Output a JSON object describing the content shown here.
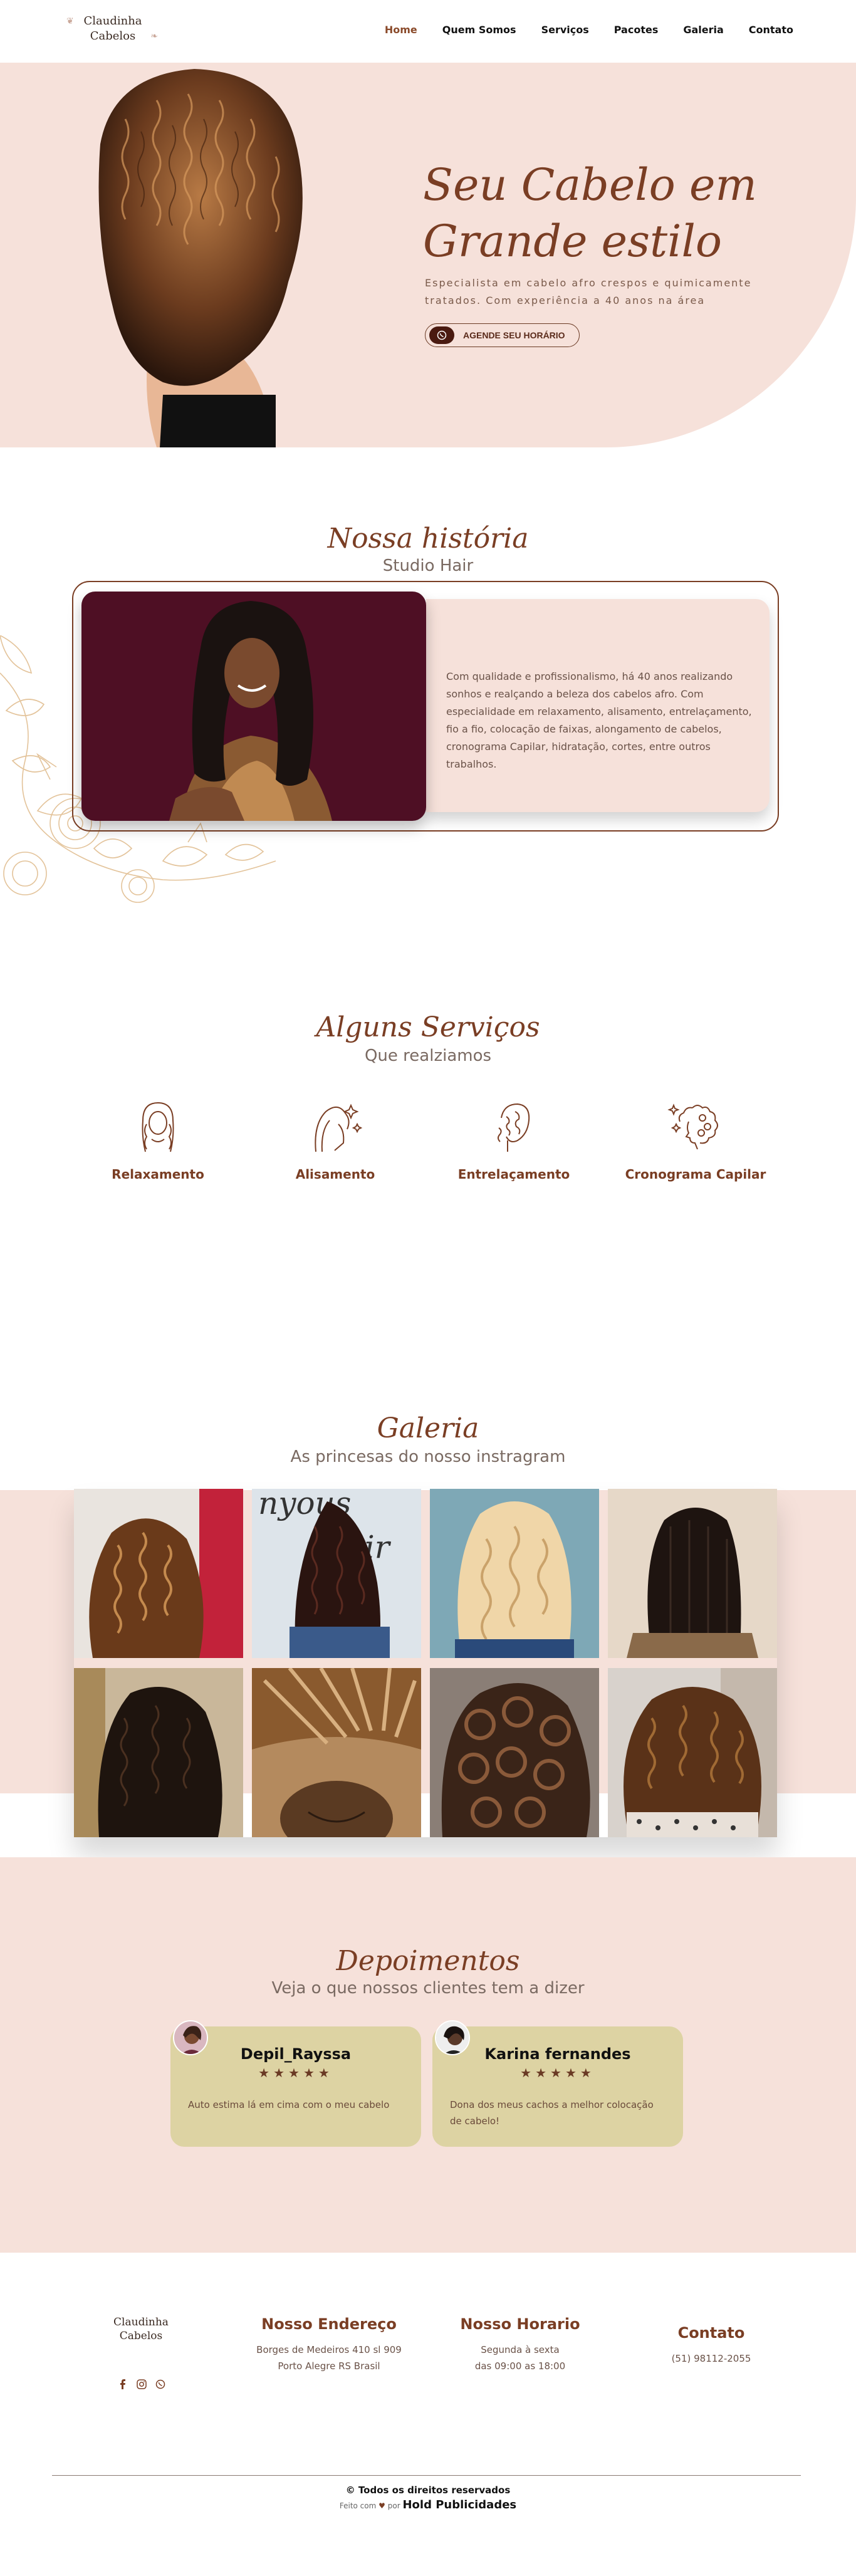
{
  "header": {
    "logo_line1": "Claudinha",
    "logo_line2": "Cabelos",
    "nav": [
      "Home",
      "Quem Somos",
      "Serviços",
      "Pacotes",
      "Galeria",
      "Contato"
    ]
  },
  "hero": {
    "title_line1": "Seu Cabelo em",
    "title_line2": "Grande estilo",
    "subtitle_line1": "Especialista em cabelo afro crespos e quimicamente",
    "subtitle_line2": "tratados. Com experiência a 40 anos na área",
    "cta_label": "AGENDE SEU HORÁRIO"
  },
  "historia": {
    "title": "Nossa história",
    "subtitle": "Studio Hair",
    "text": "Com qualidade e profissionalismo, há 40 anos realizando sonhos e realçando a beleza dos cabelos afro. Com especialidade em relaxamento, alisamento, entrelaçamento, fio a fio, colocação de faixas, alongamento de cabelos, cronograma Capilar, hidratação, cortes, entre outros trabalhos."
  },
  "servicos": {
    "title": "Alguns Serviços",
    "subtitle": "Que realziamos",
    "items": [
      {
        "label": "Relaxamento",
        "icon": "hair-relax-icon"
      },
      {
        "label": "Alisamento",
        "icon": "hair-straight-icon"
      },
      {
        "label": "Entrelaçamento",
        "icon": "braid-icon"
      },
      {
        "label": "Cronograma Capilar",
        "icon": "curly-hair-icon"
      }
    ]
  },
  "galeria": {
    "title": "Galeria",
    "subtitle": "As princesas do nosso instragram"
  },
  "depoimentos": {
    "title": "Depoimentos",
    "subtitle": "Veja o que nossos clientes tem a dizer",
    "items": [
      {
        "name": "Depil_Rayssa",
        "stars": "★★★★★",
        "text": "Auto estima lá em cima com o meu cabelo"
      },
      {
        "name": "Karina fernandes",
        "stars": "★★★★★",
        "text": "Dona dos meus cachos a melhor colocação de cabelo!"
      }
    ]
  },
  "footer": {
    "logo_line1": "Claudinha",
    "logo_line2": "Cabelos",
    "address_title": "Nosso Endereço",
    "address_line1": "Borges de Medeiros 410 sl 909",
    "address_line2": "Porto Alegre RS Brasil",
    "hours_title": "Nosso Horario",
    "hours_line1": "Segunda à sexta",
    "hours_line2": "das 09:00 as 18:00",
    "contact_title": "Contato",
    "contact_phone": "(51) 98112-2055",
    "copyright": "© Todos os direitos reservados",
    "made_prefix": "Feito com",
    "made_by": "por",
    "agency": "Hold Publicidades"
  },
  "colors": {
    "accent": "#7a3e24",
    "pink_bg": "#f6e1da",
    "card_olive": "#ddd3a3",
    "photo_bg": "#4e0f24"
  }
}
